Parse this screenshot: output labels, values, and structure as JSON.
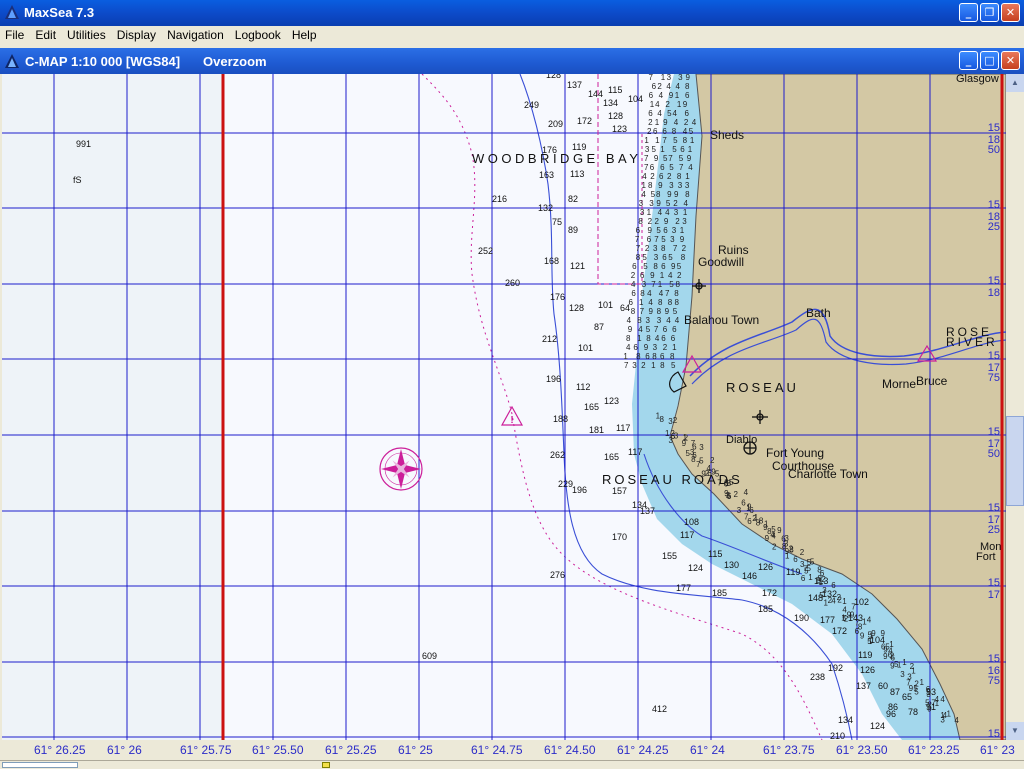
{
  "app": {
    "title": "MaxSea 7.3"
  },
  "menu": [
    "File",
    "Edit",
    "Utilities",
    "Display",
    "Navigation",
    "Logbook",
    "Help"
  ],
  "chart_window": {
    "title": "C-MAP  1:10 000 [WGS84]",
    "mode": "Overzoom"
  },
  "place_labels": {
    "woodbridge_bay": "WOODBRIDGE BAY",
    "roseau_roads": "ROSEAU ROADS",
    "roseau": "ROSEAU",
    "rose": "ROSE",
    "river": "RIVER",
    "sheds": "Sheds",
    "ruins": "Ruins",
    "goodwill": "Goodwill",
    "balahou_town": "Balahou Town",
    "bath": "Bath",
    "morne_bruce_1": "Morne",
    "morne_bruce_2": "Bruce",
    "fort_young": "Fort Young",
    "courthouse": "Courthouse",
    "charlotte_town": "Charlotte Town",
    "glasgow": "Glasgow",
    "mon": "Mon",
    "fort": "Fort",
    "diablo": "Diablo"
  },
  "left_notes": {
    "depth": "991",
    "bottom": "fS"
  },
  "lat_labels": [
    "15",
    "18",
    "50",
    "15",
    "18",
    "25",
    "15",
    "18",
    "15",
    "17",
    "75",
    "15",
    "17",
    "50",
    "15",
    "17",
    "25",
    "15",
    "17",
    "15",
    "16",
    "75",
    "15"
  ],
  "lon_labels": [
    "61° 26.25",
    "61° 26",
    "61° 25.75",
    "61° 25.50",
    "61° 25.25",
    "61° 25",
    "61° 24.75",
    "61° 24.50",
    "61° 24.25",
    "61° 24",
    "61° 23.75",
    "61° 23.50",
    "61° 23.25",
    "61° 23"
  ],
  "soundings": [
    {
      "v": "128"
    },
    {
      "v": "137"
    },
    {
      "v": "144"
    },
    {
      "v": "115"
    },
    {
      "v": "104"
    },
    {
      "v": "249"
    },
    {
      "v": "209"
    },
    {
      "v": "172"
    },
    {
      "v": "134"
    },
    {
      "v": "128"
    },
    {
      "v": "123"
    },
    {
      "v": "176"
    },
    {
      "v": "119"
    },
    {
      "v": "113"
    },
    {
      "v": "163"
    },
    {
      "v": "216"
    },
    {
      "v": "132"
    },
    {
      "v": "82"
    },
    {
      "v": "75"
    },
    {
      "v": "89"
    },
    {
      "v": "252"
    },
    {
      "v": "168"
    },
    {
      "v": "121"
    },
    {
      "v": "260"
    },
    {
      "v": "176"
    },
    {
      "v": "128"
    },
    {
      "v": "101"
    },
    {
      "v": "64"
    },
    {
      "v": "212"
    },
    {
      "v": "101"
    },
    {
      "v": "87"
    },
    {
      "v": "196"
    },
    {
      "v": "112"
    },
    {
      "v": "165"
    },
    {
      "v": "123"
    },
    {
      "v": "188"
    },
    {
      "v": "181"
    },
    {
      "v": "117"
    },
    {
      "v": "262"
    },
    {
      "v": "165"
    },
    {
      "v": "117"
    },
    {
      "v": "229"
    },
    {
      "v": "196"
    },
    {
      "v": "157"
    },
    {
      "v": "134"
    },
    {
      "v": "137"
    },
    {
      "v": "108"
    },
    {
      "v": "170"
    },
    {
      "v": "117"
    },
    {
      "v": "155"
    },
    {
      "v": "115"
    },
    {
      "v": "130"
    },
    {
      "v": "124"
    },
    {
      "v": "146"
    },
    {
      "v": "126"
    },
    {
      "v": "119"
    },
    {
      "v": "276"
    },
    {
      "v": "177"
    },
    {
      "v": "185"
    },
    {
      "v": "172"
    },
    {
      "v": "148"
    },
    {
      "v": "132"
    },
    {
      "v": "113"
    },
    {
      "v": "185"
    },
    {
      "v": "190"
    },
    {
      "v": "177"
    },
    {
      "v": "172"
    },
    {
      "v": "143"
    },
    {
      "v": "102"
    },
    {
      "v": "104"
    },
    {
      "v": "119"
    },
    {
      "v": "609"
    },
    {
      "v": "192"
    },
    {
      "v": "238"
    },
    {
      "v": "126"
    },
    {
      "v": "137"
    },
    {
      "v": "412"
    },
    {
      "v": "134"
    },
    {
      "v": "124"
    },
    {
      "v": "210"
    },
    {
      "v": "86"
    },
    {
      "v": "53"
    },
    {
      "v": "91"
    },
    {
      "v": "60"
    },
    {
      "v": "87"
    },
    {
      "v": "65"
    },
    {
      "v": "78"
    },
    {
      "v": "96"
    }
  ],
  "colors": {
    "sea": "#f7f9fe",
    "shallow": "#a3d7ec",
    "land": "#d3c8a4",
    "grid": "#1c1ccc",
    "red_line": "#cc1111",
    "magenta": "#cc1f9a",
    "depth_contour": "#3a4fd6",
    "text": "#111111"
  }
}
